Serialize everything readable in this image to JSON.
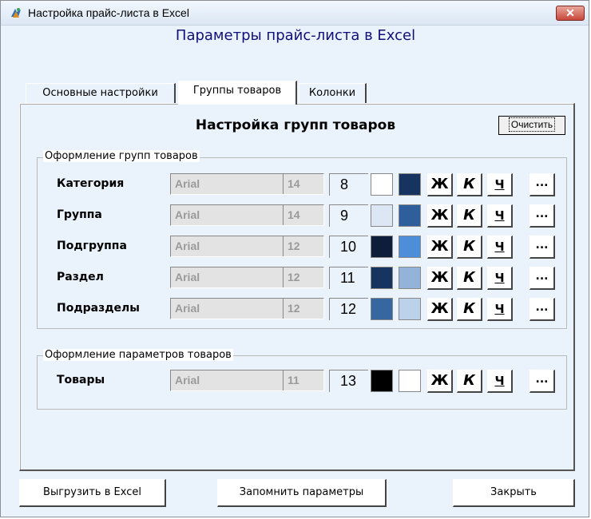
{
  "window": {
    "title": "Настройка прайс-листа в Excel",
    "close_label": "✕"
  },
  "header": {
    "title": "Параметры прайс-листа в Excel"
  },
  "tabs": [
    {
      "label": "Основные настройки"
    },
    {
      "label": "Группы товаров"
    },
    {
      "label": "Колонки"
    }
  ],
  "section": {
    "title": "Настройка групп товаров",
    "clear_label": "Очистить"
  },
  "groups_box": {
    "legend": "Оформление групп товаров",
    "rows": [
      {
        "label": "Категория",
        "font": "Arial",
        "size": "14",
        "number": "8",
        "color1": "#ffffff",
        "color2": "#17335f"
      },
      {
        "label": "Группа",
        "font": "Arial",
        "size": "14",
        "number": "9",
        "color1": "#dde6f4",
        "color2": "#2f5e9c"
      },
      {
        "label": "Подгруппа",
        "font": "Arial",
        "size": "12",
        "number": "10",
        "color1": "#0e1e3a",
        "color2": "#4e8ed8"
      },
      {
        "label": "Раздел",
        "font": "Arial",
        "size": "12",
        "number": "11",
        "color1": "#17335f",
        "color2": "#93b4d8"
      },
      {
        "label": "Подразделы",
        "font": "Arial",
        "size": "12",
        "number": "12",
        "color1": "#3667a0",
        "color2": "#bcd1ea"
      }
    ]
  },
  "params_box": {
    "legend": "Оформление параметров товаров",
    "rows": [
      {
        "label": "Товары",
        "font": "Arial",
        "size": "11",
        "number": "13",
        "color1": "#000000",
        "color2": "#ffffff"
      }
    ]
  },
  "format_buttons": {
    "bold": "Ж",
    "italic": "К",
    "underline": "Ч",
    "more": "..."
  },
  "bottom": {
    "export_label": "Выгрузить в Excel",
    "save_label": "Запомнить параметры",
    "close_label": "Закрыть"
  }
}
